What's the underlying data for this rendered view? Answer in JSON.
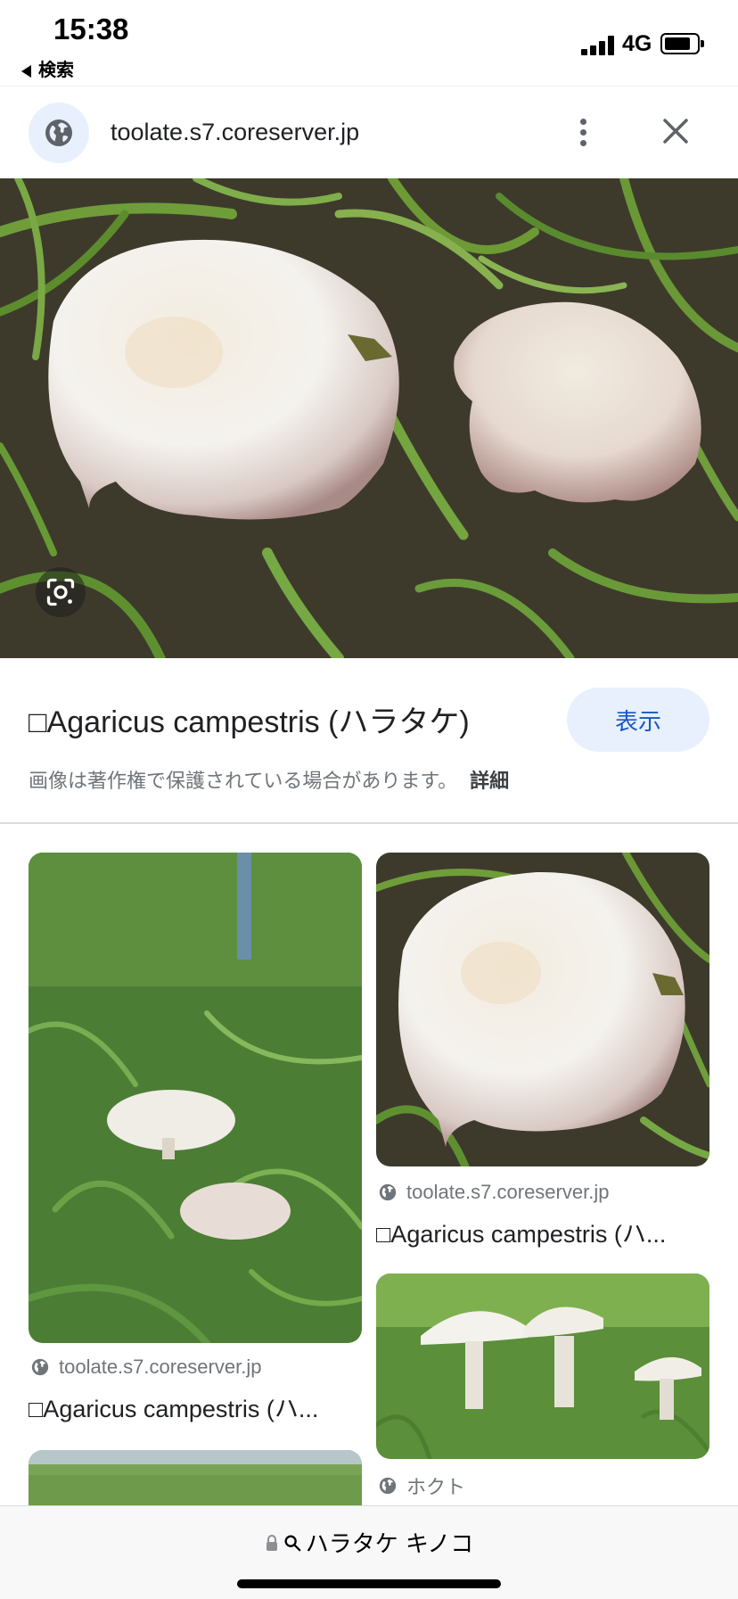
{
  "status_bar": {
    "time": "15:38",
    "back_app_label": "検索",
    "network": "4G",
    "battery_level": 0.82
  },
  "browser": {
    "url": "toolate.s7.coreserver.jp"
  },
  "preview": {
    "title": "□Agaricus campestris (ハラタケ)",
    "visit_label": "表示",
    "copyright_notice": "画像は著作権で保護されている場合があります。",
    "details_link": "詳細"
  },
  "results": [
    {
      "source": "toolate.s7.coreserver.jp",
      "title": "□Agaricus campestris (ハ..."
    },
    {
      "source": "toolate.s7.coreserver.jp",
      "title": "□Agaricus campestris (ハ..."
    },
    {
      "source": "ホクト",
      "title": ""
    }
  ],
  "search_bar": {
    "query": "ハラタケ キノコ"
  },
  "colors": {
    "accent": "#1a56c4",
    "accent_bg": "#e8f0fe",
    "muted_text": "#70757a"
  },
  "icons": [
    "globe-icon",
    "more-vert-icon",
    "close-icon",
    "lens-icon",
    "lock-icon",
    "search-icon"
  ]
}
